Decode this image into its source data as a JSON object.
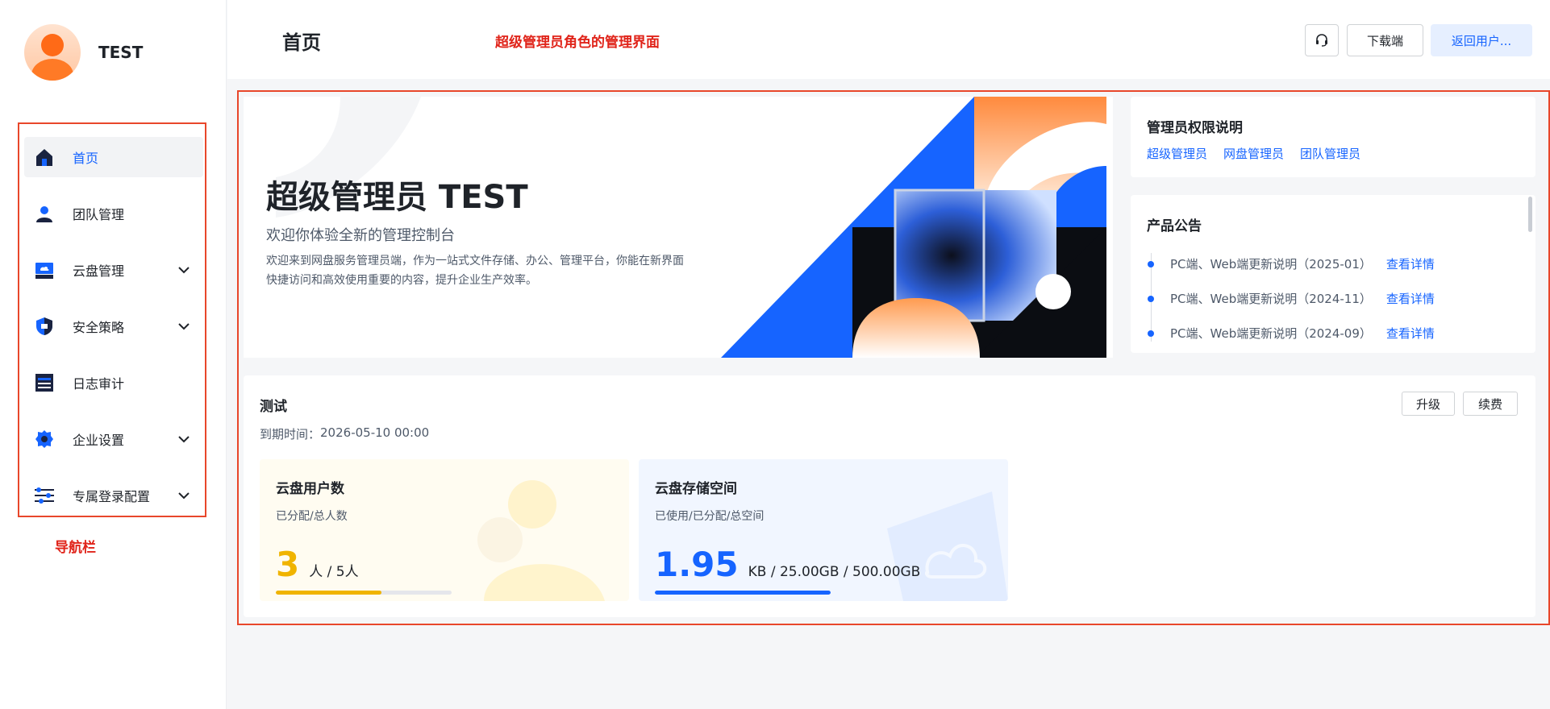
{
  "profile": {
    "name": "TEST"
  },
  "header": {
    "title": "首页",
    "annotation": "超级管理员角色的管理界面",
    "download_label": "下载端",
    "back_label": "返回用户..."
  },
  "nav": {
    "annotation": "导航栏",
    "items": [
      {
        "label": "首页",
        "icon": "home-icon",
        "active": true,
        "expandable": false
      },
      {
        "label": "团队管理",
        "icon": "team-icon",
        "active": false,
        "expandable": false
      },
      {
        "label": "云盘管理",
        "icon": "cloud-drive-icon",
        "active": false,
        "expandable": true
      },
      {
        "label": "安全策略",
        "icon": "shield-icon",
        "active": false,
        "expandable": true
      },
      {
        "label": "日志审计",
        "icon": "log-icon",
        "active": false,
        "expandable": false
      },
      {
        "label": "企业设置",
        "icon": "gear-icon",
        "active": false,
        "expandable": true
      },
      {
        "label": "专属登录配置",
        "icon": "sliders-icon",
        "active": false,
        "expandable": true
      }
    ]
  },
  "hero": {
    "title": "超级管理员 TEST",
    "subtitle": "欢迎你体验全新的管理控制台",
    "description": "欢迎来到网盘服务管理员端，作为一站式文件存储、办公、管理平台，你能在新界面快捷访问和高效使用重要的内容，提升企业生产效率。"
  },
  "permissions": {
    "title": "管理员权限说明",
    "links": [
      "超级管理员",
      "网盘管理员",
      "团队管理员"
    ]
  },
  "announcements": {
    "title": "产品公告",
    "items": [
      {
        "text": "PC端、Web端更新说明（2025-01）",
        "link": "查看详情"
      },
      {
        "text": "PC端、Web端更新说明（2024-11）",
        "link": "查看详情"
      },
      {
        "text": "PC端、Web端更新说明（2024-09）",
        "link": "查看详情"
      }
    ]
  },
  "plan": {
    "name": "测试",
    "expiry_label": "到期时间：",
    "expiry_value": "2026-05-10 00:00",
    "upgrade_label": "升级",
    "renew_label": "续费"
  },
  "stats": {
    "users": {
      "title": "云盘用户数",
      "subtitle": "已分配/总人数",
      "value": "3",
      "detail": "人 / 5人",
      "progress": 0.6
    },
    "storage": {
      "title": "云盘存储空间",
      "subtitle": "已使用/已分配/总空间",
      "value": "1.95",
      "detail": "KB / 25.00GB / 500.00GB",
      "progress": 1.0
    }
  },
  "colors": {
    "accent": "#1664ff",
    "highlight_red": "#e0241a",
    "users_yellow": "#f0b400"
  }
}
